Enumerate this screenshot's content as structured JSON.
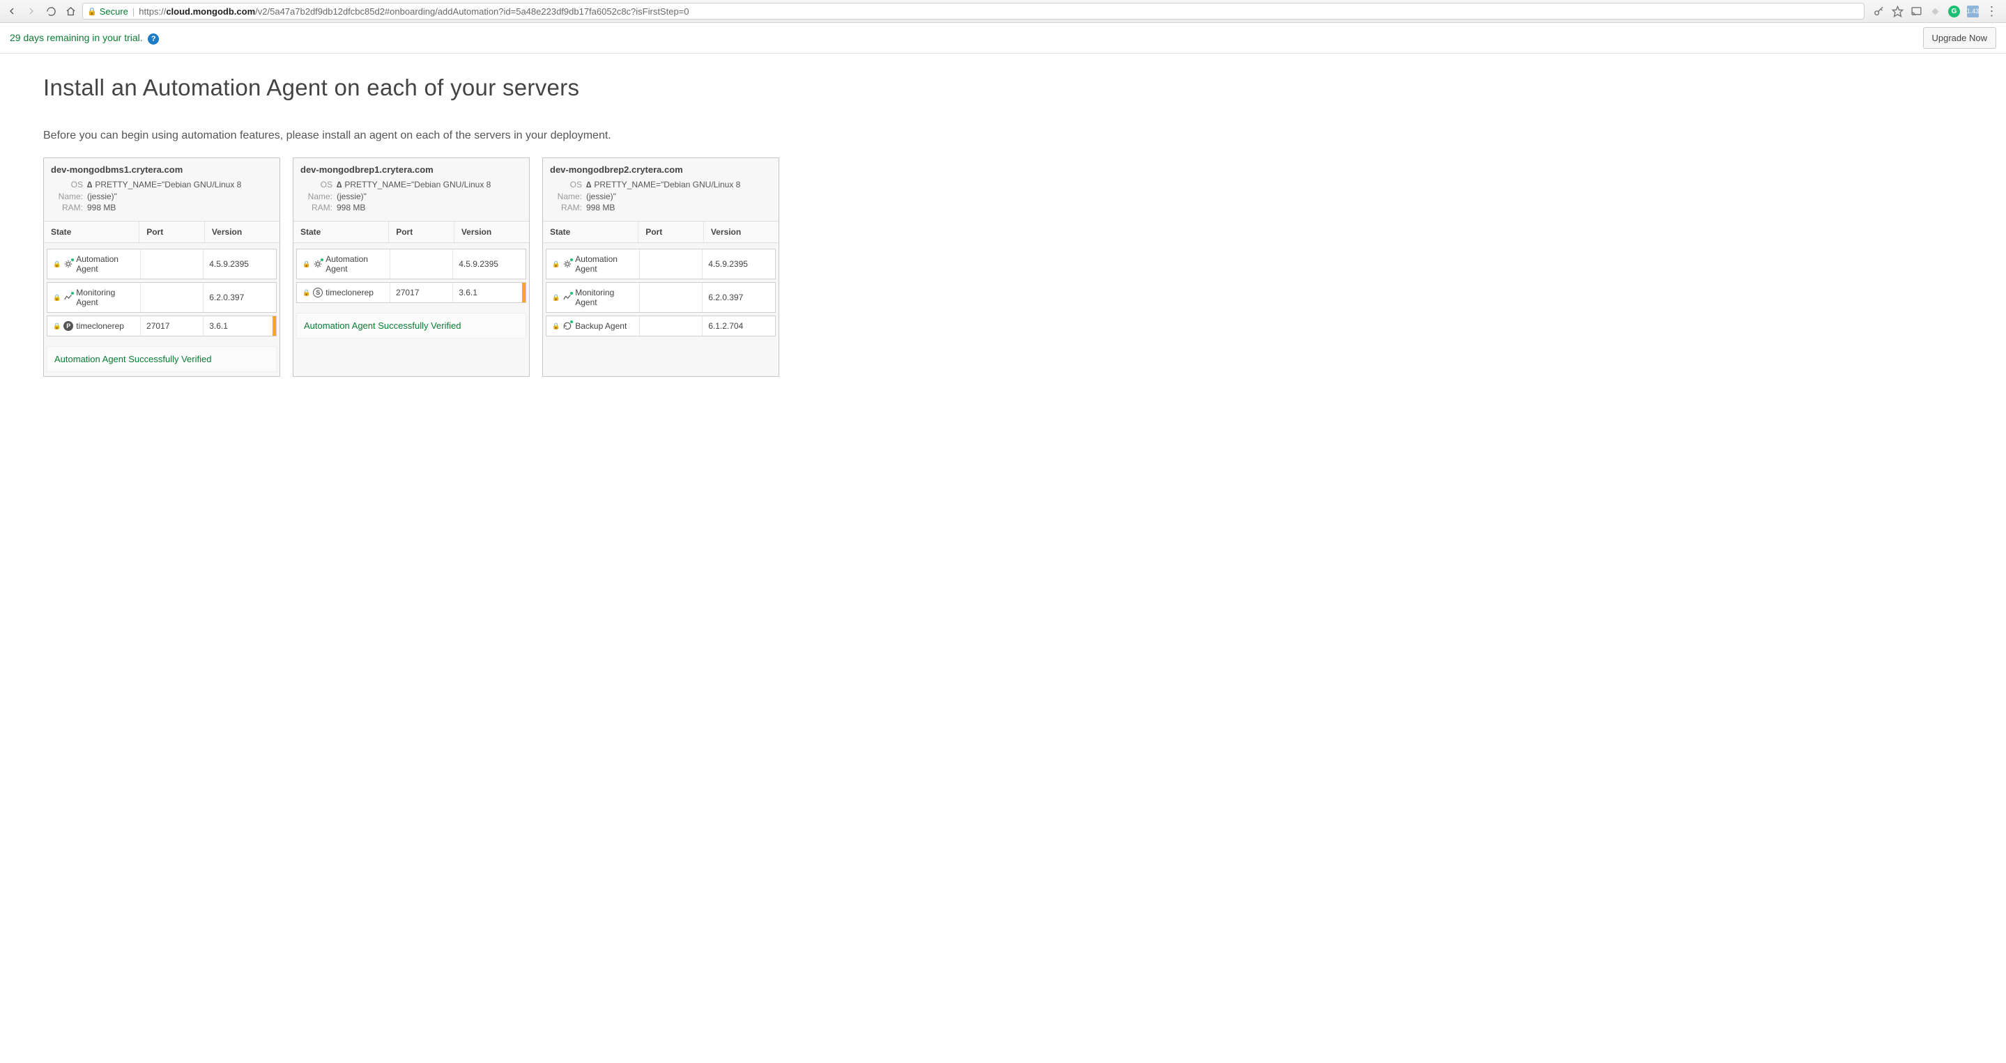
{
  "browser": {
    "secure_label": "Secure",
    "url_prefix": "https://",
    "url_domain": "cloud.mongodb.com",
    "url_path": "/v2/5a47a7b2df9db12dfcbc85d2#onboarding/addAutomation?id=5a48e223df9db17fa6052c8c?isFirstStep=0",
    "cloud_badge": "1.43"
  },
  "trial": {
    "text": "29 days remaining in your trial.",
    "upgrade_label": "Upgrade Now"
  },
  "page": {
    "title": "Install an Automation Agent on each of your servers",
    "description": "Before you can begin using automation features, please install an agent on each of the servers in your deployment."
  },
  "labels": {
    "os_name": "OS Name:",
    "ram": "RAM:",
    "col_state": "State",
    "col_port": "Port",
    "col_version": "Version",
    "verified": "Automation Agent Successfully Verified"
  },
  "servers": [
    {
      "name": "dev-mongodbms1.crytera.com",
      "os": "PRETTY_NAME=\"Debian GNU/Linux 8 (jessie)\"",
      "ram": "998 MB",
      "rows": [
        {
          "icon": "automation",
          "green": true,
          "state": "Automation Agent",
          "port": "",
          "version": "4.5.9.2395",
          "orange": false
        },
        {
          "icon": "monitoring",
          "green": true,
          "state": "Monitoring Agent",
          "port": "",
          "version": "6.2.0.397",
          "orange": false
        },
        {
          "icon": "primary",
          "green": false,
          "state": "timeclonerep",
          "port": "27017",
          "version": "3.6.1",
          "orange": true
        }
      ],
      "verified": true
    },
    {
      "name": "dev-mongodbrep1.crytera.com",
      "os": "PRETTY_NAME=\"Debian GNU/Linux 8 (jessie)\"",
      "ram": "998 MB",
      "rows": [
        {
          "icon": "automation",
          "green": true,
          "state": "Automation Agent",
          "port": "",
          "version": "4.5.9.2395",
          "orange": false
        },
        {
          "icon": "secondary",
          "green": false,
          "state": "timeclonerep",
          "port": "27017",
          "version": "3.6.1",
          "orange": true
        }
      ],
      "verified": true
    },
    {
      "name": "dev-mongodbrep2.crytera.com",
      "os": "PRETTY_NAME=\"Debian GNU/Linux 8 (jessie)\"",
      "ram": "998 MB",
      "rows": [
        {
          "icon": "automation",
          "green": true,
          "state": "Automation Agent",
          "port": "",
          "version": "4.5.9.2395",
          "orange": false
        },
        {
          "icon": "monitoring",
          "green": true,
          "state": "Monitoring Agent",
          "port": "",
          "version": "6.2.0.397",
          "orange": false
        },
        {
          "icon": "backup",
          "green": true,
          "state": "Backup Agent",
          "port": "",
          "version": "6.1.2.704",
          "orange": false
        }
      ],
      "verified": false
    }
  ]
}
